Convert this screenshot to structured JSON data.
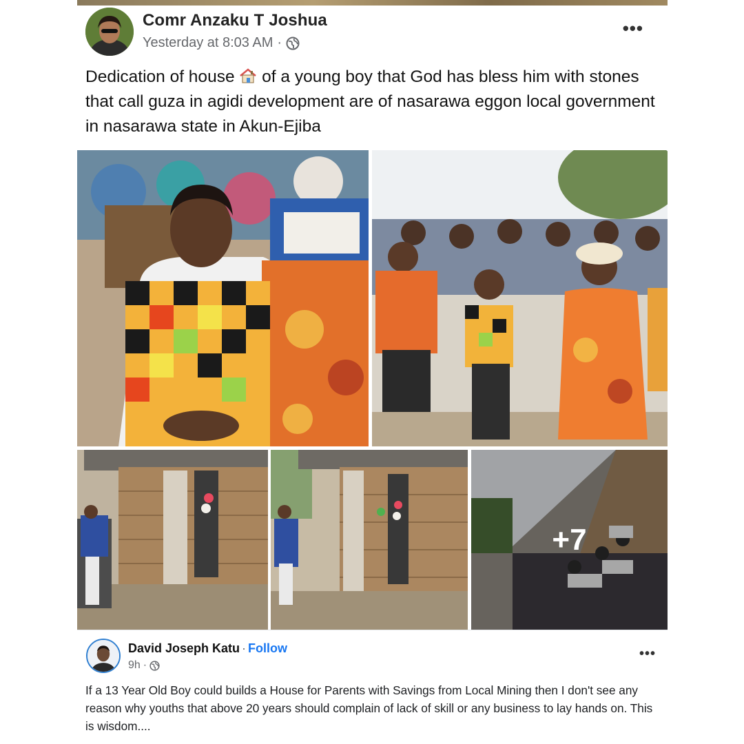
{
  "post": {
    "author": "Comr Anzaku T Joshua",
    "timestamp": "Yesterday at 8:03 AM",
    "separator": "·",
    "audience_icon": "globe-icon",
    "more_label": "•••",
    "text_before_emoji": "Dedication of house ",
    "emoji": "house-emoji",
    "text_after_emoji": " of a young boy that God has bless him with stones that call guza in agidi development are of nasarawa eggon local government in nasarawa state in Akun-Ejiba",
    "extra_photos_label": "+7"
  },
  "share": {
    "author": "David Joseph Katu",
    "separator": "·",
    "follow_label": "Follow",
    "timestamp": "9h",
    "meta_separator": "·",
    "audience_icon": "globe-icon",
    "more_label": "•••",
    "text": "If a 13 Year Old Boy could builds a House for Parents with Savings from Local Mining then I don't see any reason why youths that above  20 years should complain of lack of skill or any business to lay hands on. This is wisdom...."
  },
  "colors": {
    "link": "#1877f2",
    "secondary_text": "#65676b"
  }
}
